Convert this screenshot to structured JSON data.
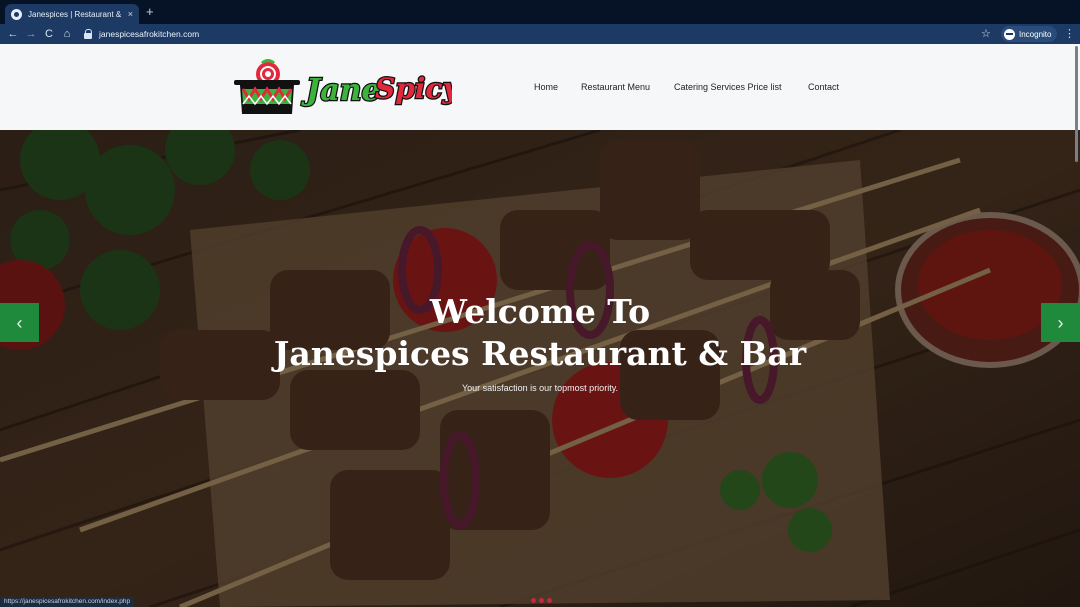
{
  "browser": {
    "tab_title": "Janespices | Restaurant & Bar",
    "tab_close": "×",
    "new_tab": "+",
    "back": "←",
    "forward": "→",
    "reload": "C",
    "home": "⌂",
    "url": "janespicesafrokitchen.com",
    "star": "☆",
    "incognito_label": "Incognito",
    "menu": "⋮",
    "status_url": "https://janespicesafrokitchen.com/index.php"
  },
  "site": {
    "logo_text": "JaneSpicy",
    "nav": [
      {
        "label": "Home"
      },
      {
        "label": "Restaurant Menu"
      },
      {
        "label": "Catering Services Price list"
      },
      {
        "label": "Contact"
      }
    ]
  },
  "hero": {
    "title_line1": "Welcome To",
    "title_line2": "Janespices Restaurant & Bar",
    "subtitle": "Your satisfaction is our topmost priority.",
    "prev_arrow": "‹",
    "next_arrow": "›",
    "slide_count": 3
  },
  "colors": {
    "accent_green": "#1f8a3c",
    "logo_red": "#e2283d",
    "logo_green": "#3cb43c",
    "browser_blue": "#1c3a63"
  }
}
